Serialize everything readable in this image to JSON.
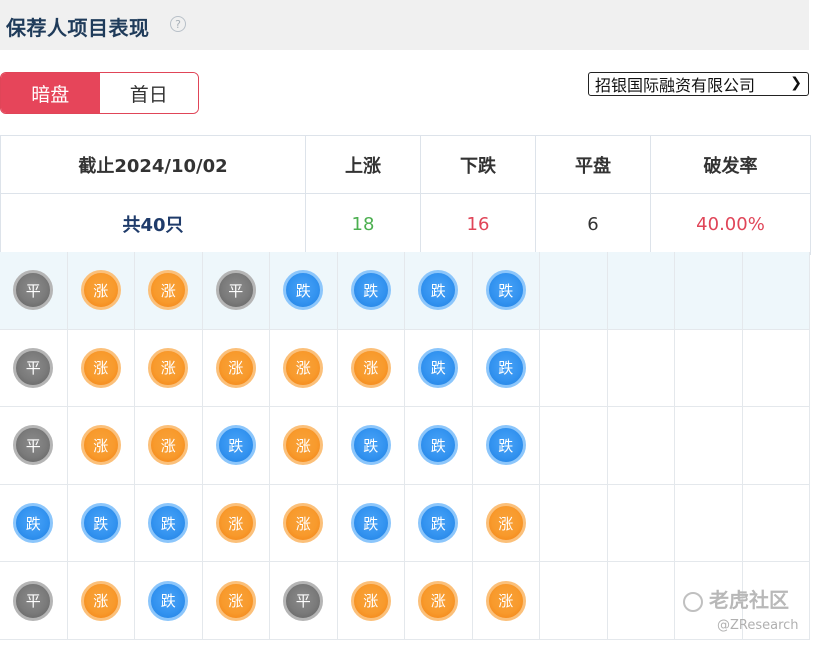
{
  "header": {
    "title": "保荐人项目表现",
    "help_icon_glyph": "?"
  },
  "tabs": [
    {
      "label": "暗盘",
      "active": true
    },
    {
      "label": "首日",
      "active": false
    }
  ],
  "select": {
    "value": "招银国际融资有限公司"
  },
  "stats": {
    "headers": [
      "截止2024/10/02",
      "上涨",
      "下跌",
      "平盘",
      "破发率"
    ],
    "total": "共40只",
    "up": "18",
    "down": "16",
    "flat": "6",
    "break_rate": "40.00%"
  },
  "results": {
    "labels": {
      "up": "涨",
      "down": "跌",
      "flat": "平"
    },
    "rows": [
      [
        "flat",
        "up",
        "up",
        "flat",
        "down",
        "down",
        "down",
        "down"
      ],
      [
        "flat",
        "up",
        "up",
        "up",
        "up",
        "up",
        "down",
        "down"
      ],
      [
        "flat",
        "up",
        "up",
        "down",
        "up",
        "down",
        "down",
        "down"
      ],
      [
        "down",
        "down",
        "down",
        "up",
        "up",
        "down",
        "down",
        "up"
      ],
      [
        "flat",
        "up",
        "down",
        "up",
        "flat",
        "up",
        "up",
        "up"
      ]
    ]
  },
  "colors": {
    "up": "#f89a2c",
    "down": "#3393f0",
    "flat": "#7a7a7a",
    "accent": "#e6455a"
  },
  "watermark": {
    "line1": "老虎社区",
    "line2": "@ZResearch"
  }
}
